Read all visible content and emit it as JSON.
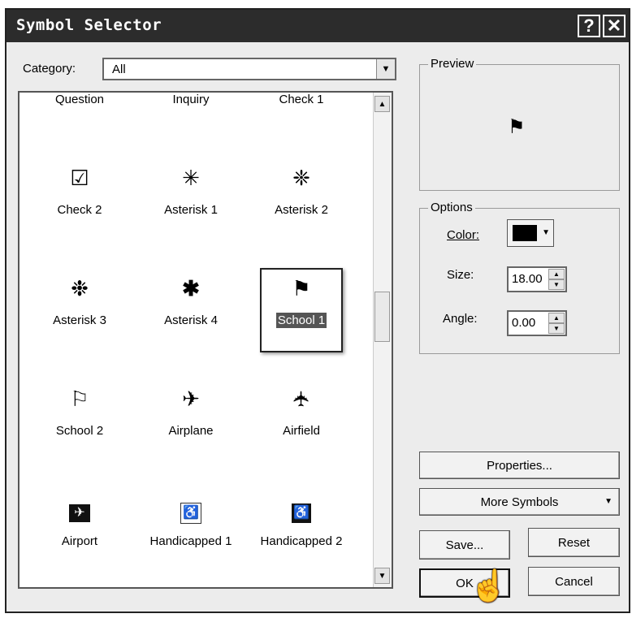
{
  "window": {
    "title": "Symbol Selector",
    "help_button": "?",
    "close_button": "✕"
  },
  "category": {
    "label": "Category:",
    "selected": "All"
  },
  "symbols": {
    "items": [
      {
        "name": "Question",
        "icon": "question-symbol",
        "glyph": ""
      },
      {
        "name": "Inquiry",
        "icon": "inquiry-symbol",
        "glyph": ""
      },
      {
        "name": "Check 1",
        "icon": "check-symbol",
        "glyph": ""
      },
      {
        "name": "Check 2",
        "icon": "checkbox-symbol",
        "glyph": "☑"
      },
      {
        "name": "Asterisk 1",
        "icon": "asterisk-thin-symbol",
        "glyph": "✳"
      },
      {
        "name": "Asterisk 2",
        "icon": "asterisk-dotted-symbol",
        "glyph": "❈"
      },
      {
        "name": "Asterisk 3",
        "icon": "asterisk-outline-symbol",
        "glyph": "❉"
      },
      {
        "name": "Asterisk 4",
        "icon": "asterisk-bold-symbol",
        "glyph": "✱"
      },
      {
        "name": "School 1",
        "icon": "school-flag-filled-symbol",
        "glyph": "⚑"
      },
      {
        "name": "School 2",
        "icon": "school-flag-outline-symbol",
        "glyph": "⚐"
      },
      {
        "name": "Airplane",
        "icon": "airplane-symbol",
        "glyph": "✈"
      },
      {
        "name": "Airfield",
        "icon": "airfield-symbol",
        "glyph": "✈"
      },
      {
        "name": "Airport",
        "icon": "airport-symbol",
        "glyph": "✈"
      },
      {
        "name": "Handicapped 1",
        "icon": "wheelchair-outline-symbol",
        "glyph": "♿"
      },
      {
        "name": "Handicapped 2",
        "icon": "wheelchair-filled-symbol",
        "glyph": "♿"
      }
    ],
    "selected": "School 1"
  },
  "preview": {
    "label": "Preview",
    "icon": "school-flag-filled-symbol"
  },
  "options": {
    "label": "Options",
    "color_label": "Color:",
    "color_value": "#000000",
    "size_label": "Size:",
    "size_value": "18.00",
    "angle_label": "Angle:",
    "angle_value": "0.00"
  },
  "buttons": {
    "properties": "Properties...",
    "more_symbols": "More Symbols",
    "save": "Save...",
    "reset": "Reset",
    "ok": "OK",
    "cancel": "Cancel"
  }
}
